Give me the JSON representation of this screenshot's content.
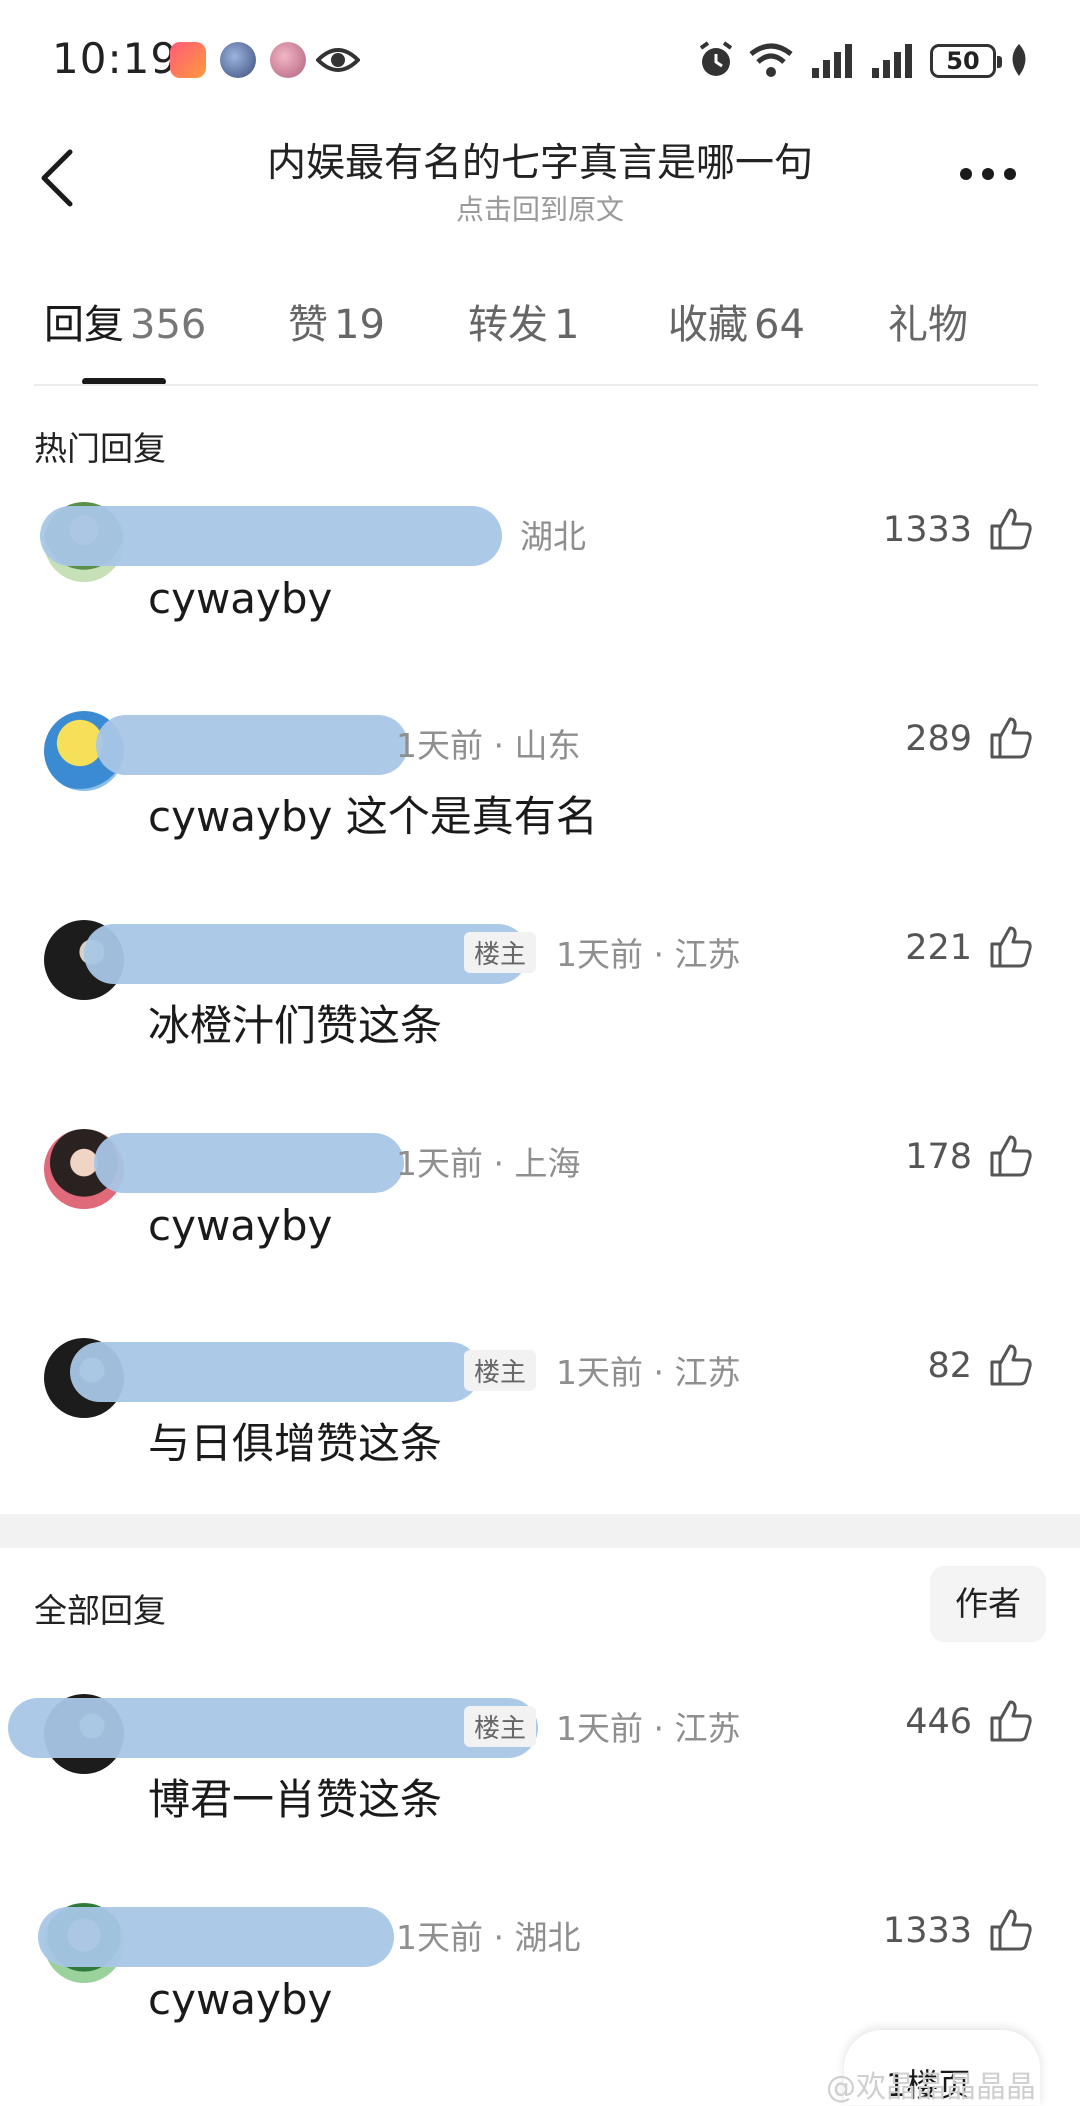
{
  "status_bar": {
    "time": "10:19",
    "battery": "50",
    "icons": [
      "app-badge-icon",
      "app-avatar-icon",
      "app-avatar-icon",
      "eye-icon",
      "alarm-icon",
      "wifi-icon",
      "signal-icon",
      "signal-icon",
      "battery-icon",
      "leaf-icon"
    ]
  },
  "header": {
    "title": "内娱最有名的七字真言是哪一句",
    "subtitle": "点击回到原文"
  },
  "tabs": [
    {
      "label": "回复",
      "count": "356"
    },
    {
      "label": "赞",
      "count": "19"
    },
    {
      "label": "转发",
      "count": "1"
    },
    {
      "label": "收藏",
      "count": "64"
    },
    {
      "label": "礼物",
      "count": ""
    }
  ],
  "hot": {
    "title": "热门回复",
    "comments": [
      {
        "meta": "湖北",
        "op": "",
        "text": "cywayby",
        "likes": "1333"
      },
      {
        "meta": "1天前 · 山东",
        "op": "",
        "text": "cywayby 这个是真有名",
        "likes": "289"
      },
      {
        "meta": "1天前 · 江苏",
        "op": "楼主",
        "text": "冰橙汁们赞这条",
        "likes": "221"
      },
      {
        "meta": "1天前 · 上海",
        "op": "",
        "text": "cywayby",
        "likes": "178"
      },
      {
        "meta": "1天前 · 江苏",
        "op": "楼主",
        "text": "与日俱增赞这条",
        "likes": "82"
      }
    ]
  },
  "all": {
    "title": "全部回复",
    "filter": "作者",
    "comments": [
      {
        "meta": "1天前 · 江苏",
        "op": "楼主",
        "text": "博君一肖赞这条",
        "likes": "446"
      },
      {
        "meta": "1天前 · 湖北",
        "op": "",
        "text": "cywayby",
        "likes": "1333"
      }
    ]
  },
  "bottom": {
    "pill_text": "1楼页",
    "watermark": "@欢晶晶晶晶晶"
  },
  "colors": {
    "accent": "#1a1a1a",
    "muted": "#8f8f8f",
    "mask": "#a8c6e6"
  }
}
